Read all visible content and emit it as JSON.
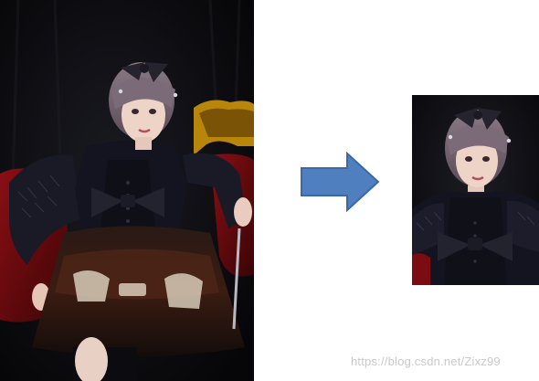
{
  "figure": {
    "source_image": {
      "subject": "cosplay photo, girl in gothic lolita dress on red velvet throne"
    },
    "arrow": {
      "color": "#4f7fbf",
      "direction": "right"
    },
    "result_image": {
      "subject": "cropped portrait of the same person"
    },
    "watermark": {
      "text": "https://blog.csdn.net/Zixz99"
    }
  }
}
